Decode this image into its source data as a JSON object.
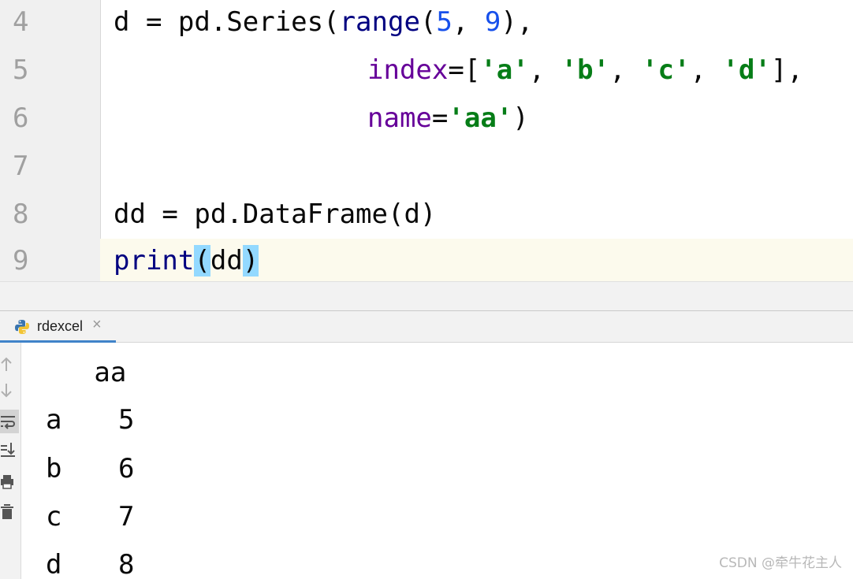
{
  "editor": {
    "current_line": "9",
    "lines": [
      {
        "num": "4",
        "indent": "",
        "tokens": []
      },
      {
        "num": "5"
      },
      {
        "num": "6"
      },
      {
        "num": "7"
      },
      {
        "num": "8"
      },
      {
        "num": "9"
      }
    ],
    "code": {
      "l4_d": "d = pd.Series(",
      "l4_range": "range",
      "l4_open": "(",
      "l4_5": "5",
      "l4_comma": ", ",
      "l4_9": "9",
      "l4_close": "),",
      "l5_index": "index",
      "l5_eq": "=[",
      "l5_a": "'a'",
      "l5_c1": ", ",
      "l5_b": "'b'",
      "l5_c2": ", ",
      "l5_c": "'c'",
      "l5_c3": ", ",
      "l5_d": "'d'",
      "l5_end": "],",
      "l6_name": "name",
      "l6_eq": "=",
      "l6_aa": "'aa'",
      "l6_close": ")",
      "l8": "dd = pd.DataFrame(d)",
      "l9_print": "print",
      "l9_open": "(",
      "l9_dd": "dd",
      "l9_close": ")"
    }
  },
  "run_panel": {
    "tab_label": "rdexcel",
    "tab_close": "×",
    "toolbar": [
      "up-arrow-icon",
      "down-arrow-icon",
      "soft-wrap-icon",
      "scroll-to-end-icon",
      "print-icon",
      "trash-icon"
    ]
  },
  "console": {
    "header": "   aa",
    "rows": [
      {
        "index": "a",
        "value": "5"
      },
      {
        "index": "b",
        "value": "6"
      },
      {
        "index": "c",
        "value": "7"
      },
      {
        "index": "d",
        "value": "8"
      }
    ]
  },
  "watermark": "CSDN @牵牛花主人",
  "colors": {
    "function": "#000080",
    "number": "#1750eb",
    "keyword_arg": "#660099",
    "string": "#067d17",
    "current_line_bg": "#fcfaed",
    "brace_highlight": "#93d9ff",
    "tab_underline": "#4083c9"
  }
}
